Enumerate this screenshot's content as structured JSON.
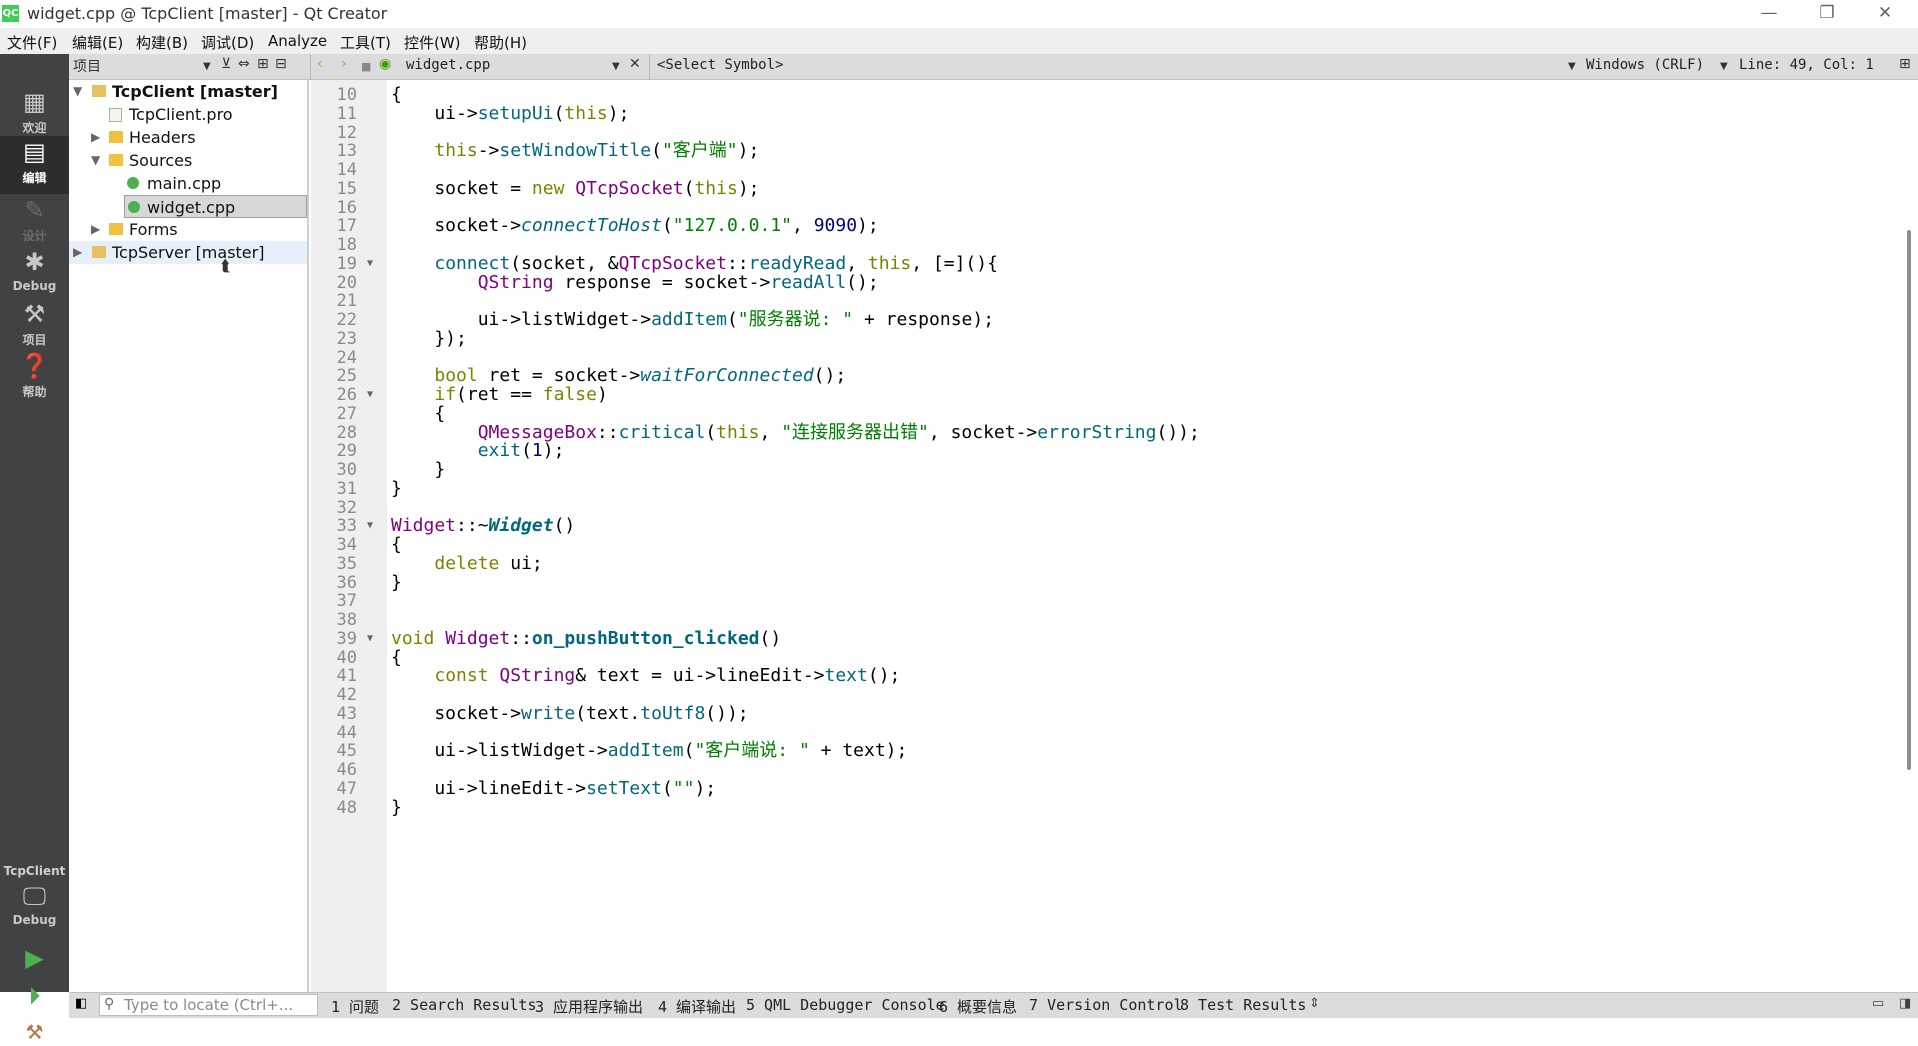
{
  "window": {
    "title": "widget.cpp @ TcpClient [master] - Qt Creator",
    "logo_text": "QC",
    "minimize_icon": "minimize-icon",
    "maximize_icon": "restore-icon",
    "close_icon": "close-icon"
  },
  "menubar": {
    "items": [
      "文件(F)",
      "编辑(E)",
      "构建(B)",
      "调试(D)",
      "Analyze",
      "工具(T)",
      "控件(W)",
      "帮助(H)"
    ]
  },
  "toolbar": {
    "panel_title": "项目",
    "open_file": "widget.cpp",
    "symbol": "<Select Symbol>",
    "encoding": "Windows (CRLF)",
    "cursor": "Line: 49, Col: 1"
  },
  "modes": [
    {
      "label": "欢迎",
      "icon": "grid-icon"
    },
    {
      "label": "编辑",
      "icon": "edit-icon"
    },
    {
      "label": "设计",
      "icon": "pencil-icon"
    },
    {
      "label": "Debug",
      "icon": "bug-icon"
    },
    {
      "label": "项目",
      "icon": "wrench-icon"
    },
    {
      "label": "帮助",
      "icon": "help-icon"
    }
  ],
  "kit": {
    "project": "TcpClient",
    "config": "Debug"
  },
  "project_tree": [
    {
      "label": "TcpClient [master]",
      "depth": 0,
      "expanded": true,
      "bold": true,
      "type": "project"
    },
    {
      "label": "TcpClient.pro",
      "depth": 1,
      "type": "pro-file"
    },
    {
      "label": "Headers",
      "depth": 1,
      "expanded": false,
      "type": "folder"
    },
    {
      "label": "Sources",
      "depth": 1,
      "expanded": true,
      "type": "folder"
    },
    {
      "label": "main.cpp",
      "depth": 2,
      "type": "cpp-file"
    },
    {
      "label": "widget.cpp",
      "depth": 2,
      "type": "cpp-file",
      "selected": true
    },
    {
      "label": "Forms",
      "depth": 1,
      "expanded": false,
      "type": "folder"
    },
    {
      "label": "TcpServer [master]",
      "depth": 0,
      "expanded": false,
      "type": "project",
      "hover": true
    }
  ],
  "code": {
    "first_line": 10,
    "fold_lines": [
      19,
      26,
      33,
      39
    ],
    "lines": [
      [
        [
          "p",
          "{"
        ]
      ],
      [
        [
          "p",
          "    ui->"
        ],
        [
          "f",
          "setupUi"
        ],
        [
          "p",
          "("
        ],
        [
          "k",
          "this"
        ],
        [
          "p",
          ");"
        ]
      ],
      [],
      [
        [
          "p",
          "    "
        ],
        [
          "k",
          "this"
        ],
        [
          "p",
          "->"
        ],
        [
          "f",
          "setWindowTitle"
        ],
        [
          "p",
          "("
        ],
        [
          "s",
          "\"客户端\""
        ],
        [
          "p",
          ");"
        ]
      ],
      [],
      [
        [
          "p",
          "    socket = "
        ],
        [
          "k",
          "new"
        ],
        [
          "p",
          " "
        ],
        [
          "t",
          "QTcpSocket"
        ],
        [
          "p",
          "("
        ],
        [
          "k",
          "this"
        ],
        [
          "p",
          ");"
        ]
      ],
      [],
      [
        [
          "p",
          "    socket->"
        ],
        [
          "fi",
          "connectToHost"
        ],
        [
          "p",
          "("
        ],
        [
          "s",
          "\"127.0.0.1\""
        ],
        [
          "p",
          ", "
        ],
        [
          "n",
          "9090"
        ],
        [
          "p",
          ");"
        ]
      ],
      [],
      [
        [
          "p",
          "    "
        ],
        [
          "f",
          "connect"
        ],
        [
          "p",
          "(socket, &"
        ],
        [
          "t",
          "QTcpSocket"
        ],
        [
          "p",
          "::"
        ],
        [
          "f",
          "readyRead"
        ],
        [
          "p",
          ", "
        ],
        [
          "k",
          "this"
        ],
        [
          "p",
          ", [=](){"
        ]
      ],
      [
        [
          "p",
          "        "
        ],
        [
          "t",
          "QString"
        ],
        [
          "p",
          " response = socket->"
        ],
        [
          "f",
          "readAll"
        ],
        [
          "p",
          "();"
        ]
      ],
      [],
      [
        [
          "p",
          "        ui->listWidget->"
        ],
        [
          "f",
          "addItem"
        ],
        [
          "p",
          "("
        ],
        [
          "s",
          "\"服务器说: \""
        ],
        [
          "p",
          " + response);"
        ]
      ],
      [
        [
          "p",
          "    });"
        ]
      ],
      [],
      [
        [
          "p",
          "    "
        ],
        [
          "k",
          "bool"
        ],
        [
          "p",
          " ret = socket->"
        ],
        [
          "fi",
          "waitForConnected"
        ],
        [
          "p",
          "();"
        ]
      ],
      [
        [
          "p",
          "    "
        ],
        [
          "k",
          "if"
        ],
        [
          "p",
          "(ret == "
        ],
        [
          "k",
          "false"
        ],
        [
          "p",
          ")"
        ]
      ],
      [
        [
          "p",
          "    {"
        ]
      ],
      [
        [
          "p",
          "        "
        ],
        [
          "t",
          "QMessageBox"
        ],
        [
          "p",
          "::"
        ],
        [
          "f",
          "critical"
        ],
        [
          "p",
          "("
        ],
        [
          "k",
          "this"
        ],
        [
          "p",
          ", "
        ],
        [
          "s",
          "\"连接服务器出错\""
        ],
        [
          "p",
          ", socket->"
        ],
        [
          "f",
          "errorString"
        ],
        [
          "p",
          "());"
        ]
      ],
      [
        [
          "p",
          "        "
        ],
        [
          "f",
          "exit"
        ],
        [
          "p",
          "("
        ],
        [
          "n",
          "1"
        ],
        [
          "p",
          ");"
        ]
      ],
      [
        [
          "p",
          "    }"
        ]
      ],
      [
        [
          "p",
          "}"
        ]
      ],
      [],
      [
        [
          "t",
          "Widget"
        ],
        [
          "p",
          "::~"
        ],
        [
          "di",
          "Widget"
        ],
        [
          "p",
          "()"
        ]
      ],
      [
        [
          "p",
          "{"
        ]
      ],
      [
        [
          "p",
          "    "
        ],
        [
          "k",
          "delete"
        ],
        [
          "p",
          " ui;"
        ]
      ],
      [
        [
          "p",
          "}"
        ]
      ],
      [],
      [],
      [
        [
          "k",
          "void"
        ],
        [
          "p",
          " "
        ],
        [
          "t",
          "Widget"
        ],
        [
          "p",
          "::"
        ],
        [
          "d",
          "on_pushButton_clicked"
        ],
        [
          "p",
          "()"
        ]
      ],
      [
        [
          "p",
          "{"
        ]
      ],
      [
        [
          "p",
          "    "
        ],
        [
          "k",
          "const"
        ],
        [
          "p",
          " "
        ],
        [
          "t",
          "QString"
        ],
        [
          "p",
          "& text = ui->lineEdit->"
        ],
        [
          "f",
          "text"
        ],
        [
          "p",
          "();"
        ]
      ],
      [],
      [
        [
          "p",
          "    socket->"
        ],
        [
          "f",
          "write"
        ],
        [
          "p",
          "(text."
        ],
        [
          "f",
          "toUtf8"
        ],
        [
          "p",
          "());"
        ]
      ],
      [],
      [
        [
          "p",
          "    ui->listWidget->"
        ],
        [
          "f",
          "addItem"
        ],
        [
          "p",
          "("
        ],
        [
          "s",
          "\"客户端说: \""
        ],
        [
          "p",
          " + text);"
        ]
      ],
      [],
      [
        [
          "p",
          "    ui->lineEdit->"
        ],
        [
          "f",
          "setText"
        ],
        [
          "p",
          "("
        ],
        [
          "s",
          "\"\""
        ],
        [
          "p",
          ");"
        ]
      ],
      [
        [
          "p",
          "}"
        ]
      ]
    ]
  },
  "statusbar": {
    "locator_placeholder": "Type to locate (Ctrl+...",
    "tabs": [
      "1 问题",
      "2 Search Results",
      "3 应用程序输出",
      "4 编译输出",
      "5 QML Debugger Console",
      "6 概要信息",
      "7 Version Control",
      "8 Test Results"
    ]
  },
  "colors": {
    "keyword": "#808000",
    "type": "#800080",
    "function": "#00677c",
    "string": "#008000",
    "number": "#000080",
    "modebar": "#404244"
  }
}
